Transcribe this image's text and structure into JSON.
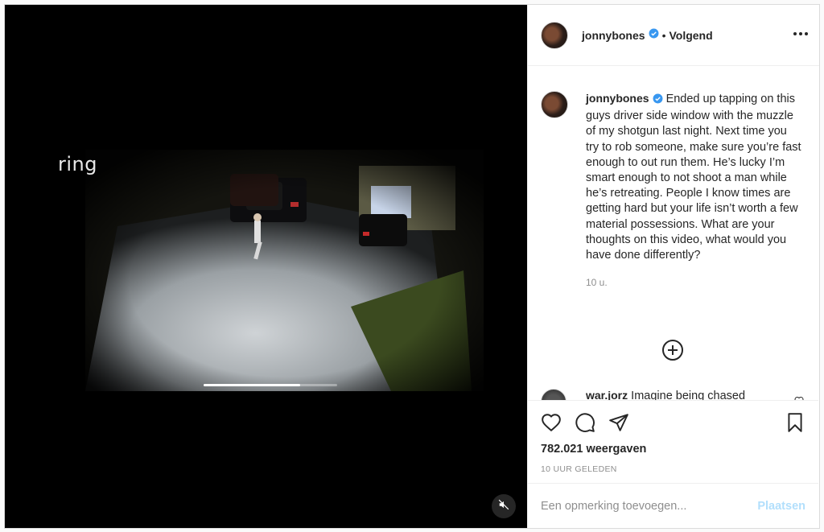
{
  "media": {
    "overlay_logo": "ring",
    "progress": 0.72
  },
  "header": {
    "username": "jonnybones",
    "separator": "•",
    "follow_label": "Volgend"
  },
  "caption": {
    "username": "jonnybones",
    "text": "Ended up tapping on this guys driver side window with the muzzle of my shotgun last night. Next time you try to rob someone, make sure you’re fast enough to out run them. He’s lucky I’m smart enough to not shoot a man while he’s retreating. People I know times are getting hard but your life isn’t worth a few material possessions. What are your thoughts on this video, what would you have done differently?",
    "time": "10 u."
  },
  "comment_preview": {
    "username": "war.jorz",
    "text": "Imagine being chased"
  },
  "stats": {
    "views": "782.021 weergaven",
    "posted": "10 UUR GELEDEN"
  },
  "add_comment": {
    "placeholder": "Een opmerking toevoegen...",
    "post_label": "Plaatsen"
  },
  "icons": {
    "like": "heart-icon",
    "comment": "speech-bubble-icon",
    "share": "paper-plane-icon",
    "save": "bookmark-icon",
    "more": "more-dots-icon",
    "verified": "verified-badge-icon",
    "mute": "speaker-muted-icon",
    "load_more": "plus-circle-icon"
  },
  "colors": {
    "verified": "#3897f0",
    "post_disabled": "#b2dffc",
    "muted_text": "#8e8e8e"
  }
}
